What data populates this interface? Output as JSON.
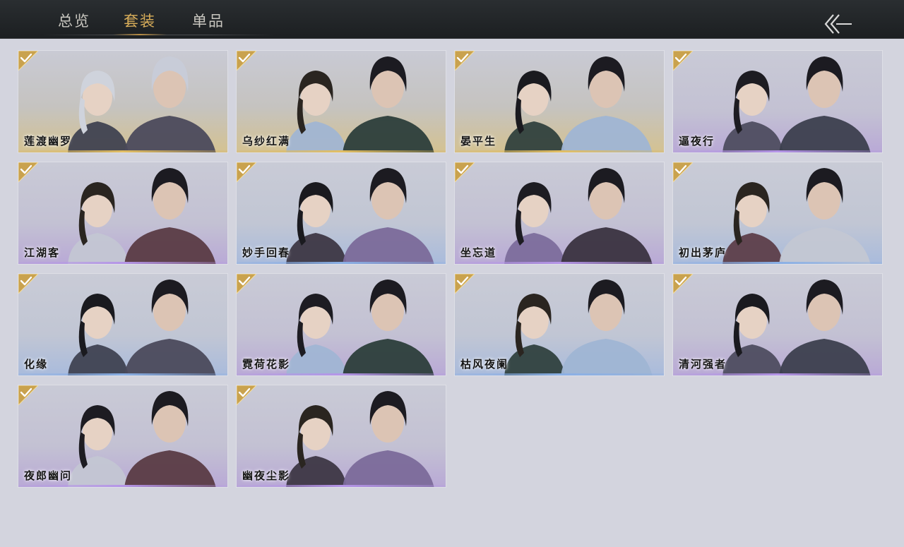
{
  "tabs": [
    {
      "label": "总览",
      "active": false
    },
    {
      "label": "套装",
      "active": true
    },
    {
      "label": "单品",
      "active": false
    }
  ],
  "back_icon": "double-chevron-left-arrow-icon",
  "colors": {
    "active_tab": "#d9ae5a",
    "inactive_tab": "#c9c7c0",
    "check_badge": "#c9a24e",
    "gold_rarity": "#e2be62",
    "purple_rarity": "#b595e8",
    "blue_rarity": "#8ab0e6"
  },
  "outfits": [
    {
      "name": "莲渡幽罗",
      "owned": true,
      "rarity": "gold"
    },
    {
      "name": "乌纱红满",
      "owned": true,
      "rarity": "gold"
    },
    {
      "name": "晏平生",
      "owned": true,
      "rarity": "gold"
    },
    {
      "name": "逼夜行",
      "owned": true,
      "rarity": "purple"
    },
    {
      "name": "江湖客",
      "owned": true,
      "rarity": "purple"
    },
    {
      "name": "妙手回春",
      "owned": true,
      "rarity": "blue"
    },
    {
      "name": "坐忘道",
      "owned": true,
      "rarity": "purple"
    },
    {
      "name": "初出茅庐",
      "owned": true,
      "rarity": "blue"
    },
    {
      "name": "化缘",
      "owned": true,
      "rarity": "blue"
    },
    {
      "name": "霓荷花影",
      "owned": true,
      "rarity": "purple"
    },
    {
      "name": "枯风夜阑",
      "owned": true,
      "rarity": "blue"
    },
    {
      "name": "清河强者",
      "owned": true,
      "rarity": "purple"
    },
    {
      "name": "夜郎幽问",
      "owned": true,
      "rarity": "purple"
    },
    {
      "name": "幽夜尘影",
      "owned": true,
      "rarity": "purple"
    }
  ]
}
